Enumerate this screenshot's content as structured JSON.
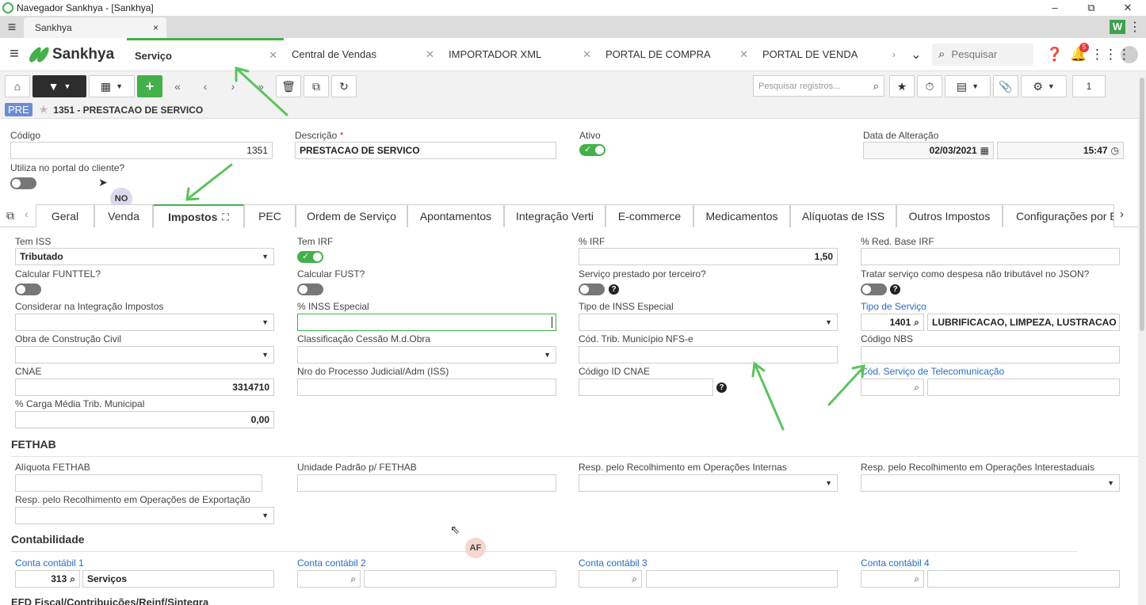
{
  "window": {
    "title": "Navegador Sankhya - [Sankhya]",
    "minimize": "–",
    "maximize": "⧉",
    "close": "✕"
  },
  "browser_tab": {
    "label": "Sankhya",
    "close": "×"
  },
  "app": {
    "logo_text": "Sankhya",
    "tabs": [
      {
        "label": "Serviço"
      },
      {
        "label": "Central de Vendas"
      },
      {
        "label": "IMPORTADOR XML"
      },
      {
        "label": "PORTAL DE COMPRA"
      },
      {
        "label": "PORTAL DE VENDA"
      }
    ],
    "search_placeholder": "Pesquisar",
    "notification_count": "5"
  },
  "toolbar": {
    "search_placeholder": "Pesquisar registros...",
    "page": "1"
  },
  "record": {
    "tag": "PRE",
    "title": "1351 - PRESTACAO DE SERVICO"
  },
  "header_fields": {
    "codigo_label": "Código",
    "codigo_value": "1351",
    "descricao_label": "Descrição",
    "descricao_req": "*",
    "descricao_value": "PRESTACAO DE SERVICO",
    "ativo_label": "Ativo",
    "data_label": "Data de Alteração",
    "data_value": "02/03/2021",
    "hora_value": "15:47",
    "portal_label": "Utiliza no portal do cliente?"
  },
  "bubbles": {
    "no": "NO",
    "af": "AF"
  },
  "tabs": [
    {
      "label": "Geral"
    },
    {
      "label": "Venda"
    },
    {
      "label": "Impostos"
    },
    {
      "label": "PEC"
    },
    {
      "label": "Ordem de Serviço"
    },
    {
      "label": "Apontamentos"
    },
    {
      "label": "Integração Verti"
    },
    {
      "label": "E-commerce"
    },
    {
      "label": "Medicamentos"
    },
    {
      "label": "Alíquotas de ISS"
    },
    {
      "label": "Outros Impostos"
    },
    {
      "label": "Configurações por E"
    }
  ],
  "impostos": {
    "tem_iss_label": "Tem ISS",
    "tem_iss_value": "Tributado",
    "tem_irf_label": "Tem IRF",
    "irf_label": "% IRF",
    "irf_value": "1,50",
    "red_base_label": "% Red. Base IRF",
    "funttel_label": "Calcular FUNTTEL?",
    "fust_label": "Calcular FUST?",
    "terceiro_label": "Serviço prestado por terceiro?",
    "despesa_label": "Tratar serviço como despesa não tributável no JSON?",
    "considerar_label": "Considerar na Integração Impostos",
    "inss_especial_label": "% INSS Especial",
    "tipo_inss_label": "Tipo de INSS Especial",
    "tipo_servico_label": "Tipo de Serviço",
    "tipo_servico_code": "1401",
    "tipo_servico_desc": "LUBRIFICACAO, LIMPEZA, LUSTRACAO",
    "obra_label": "Obra de Construção Civil",
    "cessao_label": "Classificação Cessão M.d.Obra",
    "cod_trib_label": "Cód. Trib. Município NFS-e",
    "nbs_label": "Código NBS",
    "cnae_label": "CNAE",
    "cnae_value": "3314710",
    "processo_label": "Nro do Processo Judicial/Adm (ISS)",
    "id_cnae_label": "Código ID CNAE",
    "telecom_label": "Cód. Serviço de Telecomunicação",
    "carga_label": "% Carga Média Trib. Municipal",
    "carga_value": "0,00"
  },
  "fethab": {
    "title": "FETHAB",
    "aliquota_label": "Alíquota FETHAB",
    "unidade_label": "Unidade Padrão p/ FETHAB",
    "internas_label": "Resp. pelo Recolhimento em Operações Internas",
    "interestaduais_label": "Resp. pelo Recolhimento em Operações Interestaduais",
    "exportacao_label": "Resp. pelo Recolhimento em Operações de Exportação"
  },
  "contabilidade": {
    "title": "Contabilidade",
    "conta1_label": "Conta contábil 1",
    "conta1_code": "313",
    "conta1_desc": "Serviços",
    "conta2_label": "Conta contábil 2",
    "conta3_label": "Conta contábil 3",
    "conta4_label": "Conta contábil 4"
  },
  "efd": {
    "title": "EFD Fiscal/Contribuições/Reinf/Sintegra"
  },
  "colors": {
    "accent": "#43b049",
    "link": "#2a6cc4",
    "annotation_arrow": "#5cc25f"
  }
}
